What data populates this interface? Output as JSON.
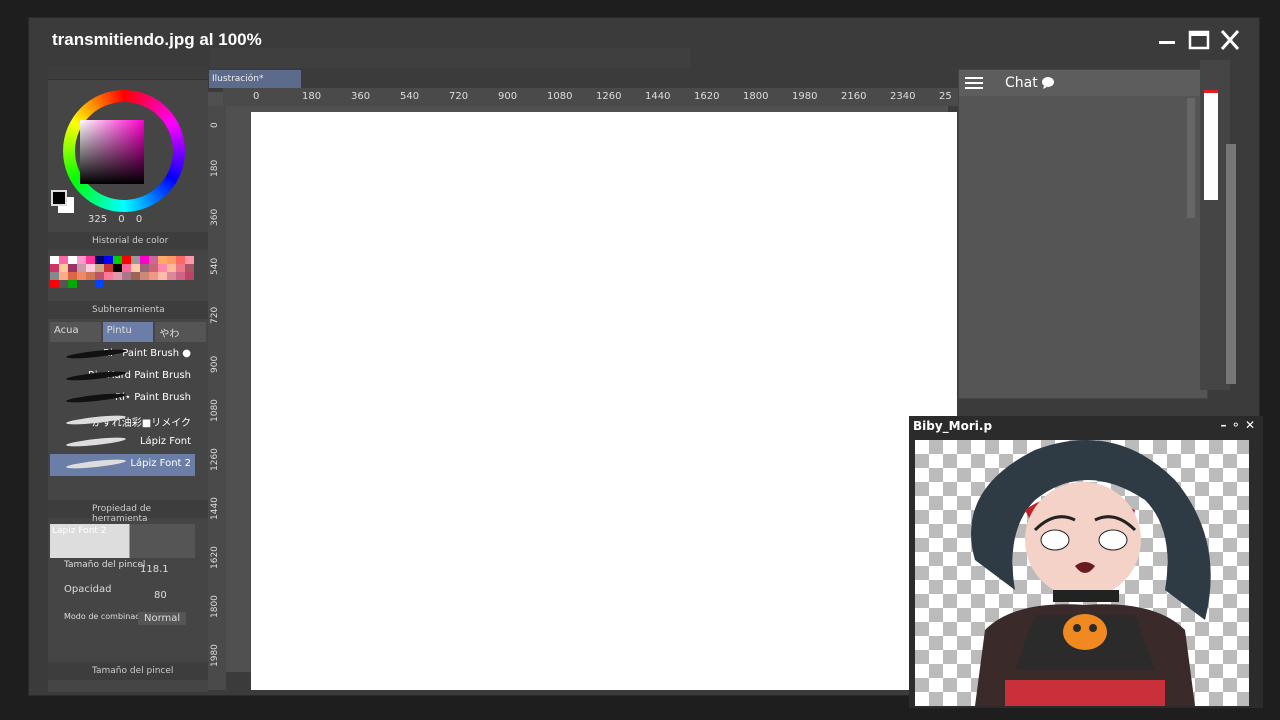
{
  "window": {
    "title": "transmitiendo.jpg al 100%",
    "minimize_icon": "minimize-icon",
    "maximize_icon": "maximize-icon",
    "close_icon": "close-icon"
  },
  "document": {
    "tab_label": "Ilustración*"
  },
  "color_panel": {
    "hue": "325",
    "saturation": "0",
    "value": "0"
  },
  "color_history": {
    "title": "Historial de color",
    "swatches": [
      "#ffffff",
      "#ff66aa",
      "#ffffff",
      "#ff99cc",
      "#ff3399",
      "#000066",
      "#0000ff",
      "#00cc00",
      "#ff0000",
      "#999999",
      "#ff00cc",
      "#cc6699",
      "#ffaa66",
      "#ff9966",
      "#ff6666",
      "#ff99aa",
      "#cc3366",
      "#ffcc99",
      "#993366",
      "#cc99aa",
      "#ffccdd",
      "#ccaa88",
      "#cc3333",
      "#000000",
      "#ff6699",
      "#ffccaa",
      "#996677",
      "#cc6677",
      "#ff88aa",
      "#ffbb99",
      "#ee7788",
      "#aa5566",
      "#888888",
      "#ffaa88",
      "#dd6644",
      "#ee8866",
      "#cc7755",
      "#bb5566",
      "#ff7799",
      "#dd99aa",
      "#aa7788",
      "#996655",
      "#cc8877",
      "#ee9988",
      "#ffbbaa",
      "#dd8899",
      "#cc6688",
      "#bb4466",
      "#ff0000",
      "#555555",
      "#00aa00",
      "#454545",
      "#454545",
      "#0044ff",
      "#454545",
      "#454545",
      "#454545",
      "#454545",
      "#454545",
      "#454545",
      "#454545",
      "#454545",
      "#454545",
      "#454545"
    ]
  },
  "subtool": {
    "title": "Subherramienta",
    "tabs": [
      "Acua",
      "Pintu",
      "やわ"
    ],
    "brushes": [
      "Ri⋆ Paint Brush ●",
      "Ri⋆ Hard Paint Brush",
      "Ri⋆ Paint Brush",
      "かすれ油彩■リメイク",
      "Lápiz Font",
      "Lápiz Font 2"
    ]
  },
  "tool_property": {
    "title": "Propiedad de herramienta",
    "preview_label": "Lápiz Font 2",
    "brush_size_label": "Tamaño del pincel",
    "brush_size_value": "118.1",
    "opacity_label": "Opacidad",
    "opacity_value": "80",
    "blend_label": "Modo de combinación",
    "blend_value": "Normal",
    "brush_size_section": "Tamaño del pincel"
  },
  "rulers": {
    "top": [
      "0",
      "180",
      "360",
      "540",
      "720",
      "900",
      "1080",
      "1260",
      "1440",
      "1620",
      "1800",
      "1980",
      "2160",
      "2340",
      "25"
    ],
    "left": [
      "0",
      "180",
      "360",
      "540",
      "720",
      "900",
      "1080",
      "1260",
      "1440",
      "1620",
      "1800",
      "1980"
    ]
  },
  "chat": {
    "title": "Chat"
  },
  "overlay": {
    "title": "Biby_Mori.p"
  }
}
